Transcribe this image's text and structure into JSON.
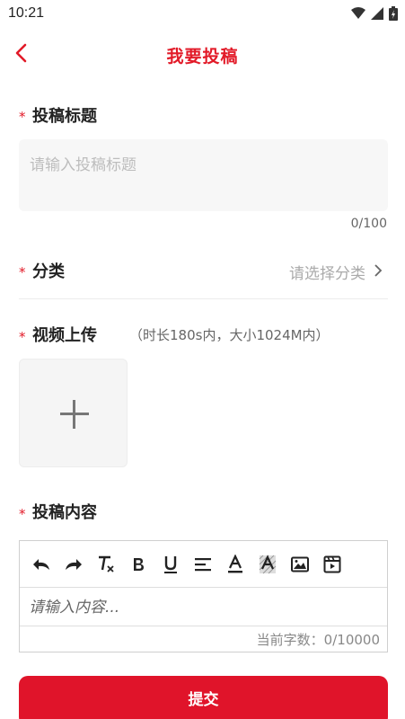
{
  "status_bar": {
    "time": "10:21"
  },
  "nav": {
    "title": "我要投稿"
  },
  "form": {
    "required_mark": "*",
    "title_label": "投稿标题",
    "title_placeholder": "请输入投稿标题",
    "title_counter": "0/100",
    "category_label": "分类",
    "category_placeholder": "请选择分类",
    "video_label": "视频上传",
    "video_hint": "（时长180s内，大小1024M内）",
    "content_label": "投稿内容",
    "content_placeholder": "请输入内容...",
    "word_count": "当前字数：0/10000"
  },
  "editor_toolbar": [
    {
      "name": "undo-icon",
      "glyph": "↶"
    },
    {
      "name": "redo-icon",
      "glyph": "↷"
    },
    {
      "name": "clear-format-icon",
      "glyph": "Tx"
    },
    {
      "name": "bold-icon",
      "glyph": "B"
    },
    {
      "name": "underline-icon",
      "glyph": "U"
    },
    {
      "name": "align-icon",
      "glyph": "≡"
    },
    {
      "name": "font-color-icon",
      "glyph": "A"
    },
    {
      "name": "background-color-icon",
      "glyph": "A"
    },
    {
      "name": "image-icon",
      "glyph": "image"
    },
    {
      "name": "video-icon",
      "glyph": "video"
    }
  ],
  "actions": {
    "submit_label": "提交"
  },
  "colors": {
    "accent": "#e21a28"
  }
}
